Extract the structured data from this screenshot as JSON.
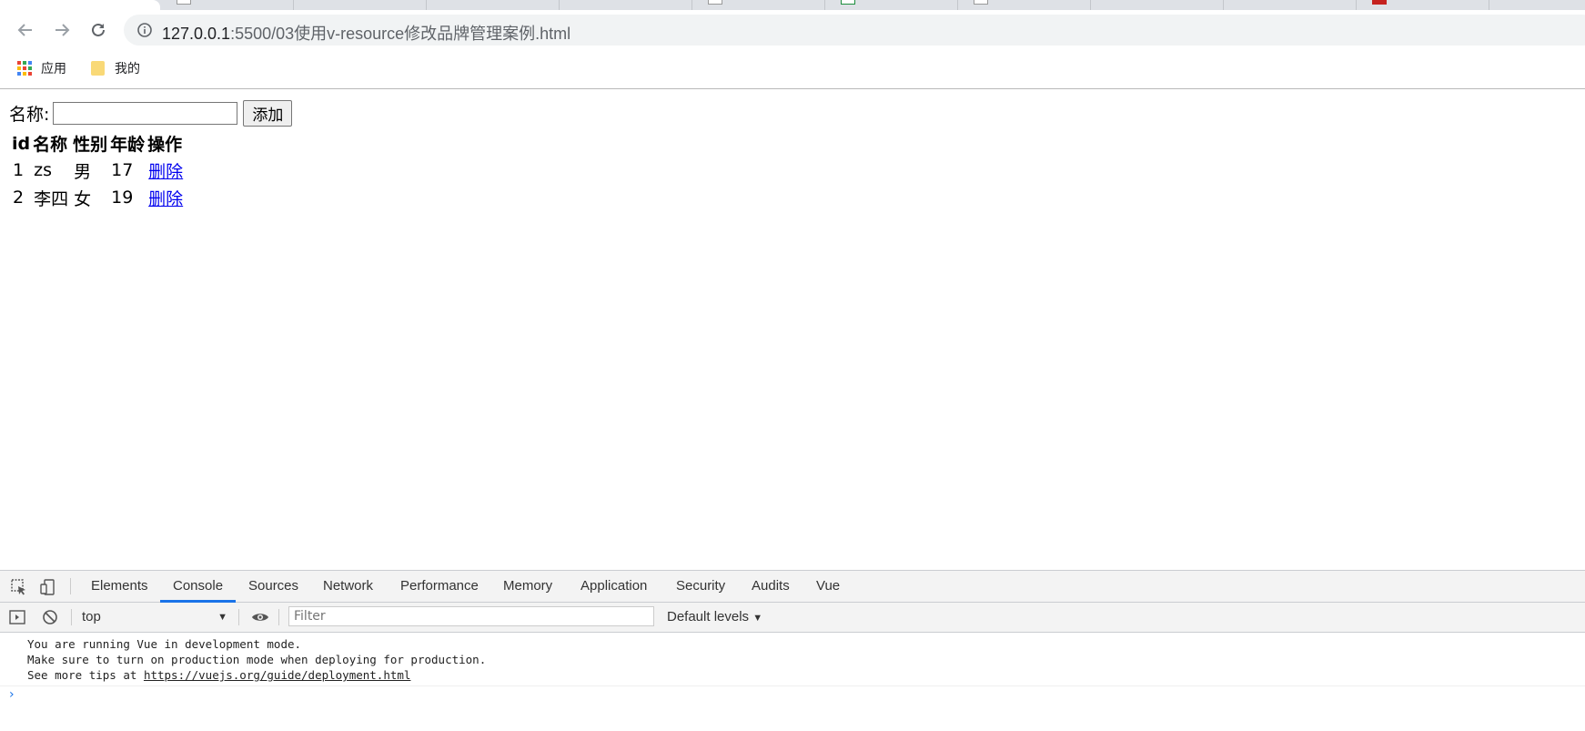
{
  "browser": {
    "address": {
      "host": "127.0.0.1",
      "path": ":5500/03使用v-resource修改品牌管理案例.html"
    },
    "bookmarks": [
      {
        "label": "应用"
      },
      {
        "label": "我的"
      }
    ]
  },
  "page": {
    "form": {
      "name_label": "名称:",
      "name_value": "",
      "add_button": "添加"
    },
    "table": {
      "headers": [
        "id",
        "名称",
        "性别",
        "年龄",
        "操作"
      ],
      "rows": [
        {
          "id": "1",
          "name": "zs",
          "gender": "男",
          "age": "17",
          "action": "删除"
        },
        {
          "id": "2",
          "name": "李四",
          "gender": "女",
          "age": "19",
          "action": "删除"
        }
      ]
    }
  },
  "devtools": {
    "tabs": [
      "Elements",
      "Console",
      "Sources",
      "Network",
      "Performance",
      "Memory",
      "Application",
      "Security",
      "Audits",
      "Vue"
    ],
    "active_tab": "Console",
    "context": "top",
    "filter_placeholder": "Filter",
    "levels": "Default levels",
    "messages": [
      "You are running Vue in development mode.",
      "Make sure to turn on production mode when deploying for production.",
      "See more tips at "
    ],
    "message_link": "https://vuejs.org/guide/deployment.html",
    "prompt": "›"
  },
  "colors": {
    "accent": "#1a73e8",
    "link": "#0000ee"
  }
}
